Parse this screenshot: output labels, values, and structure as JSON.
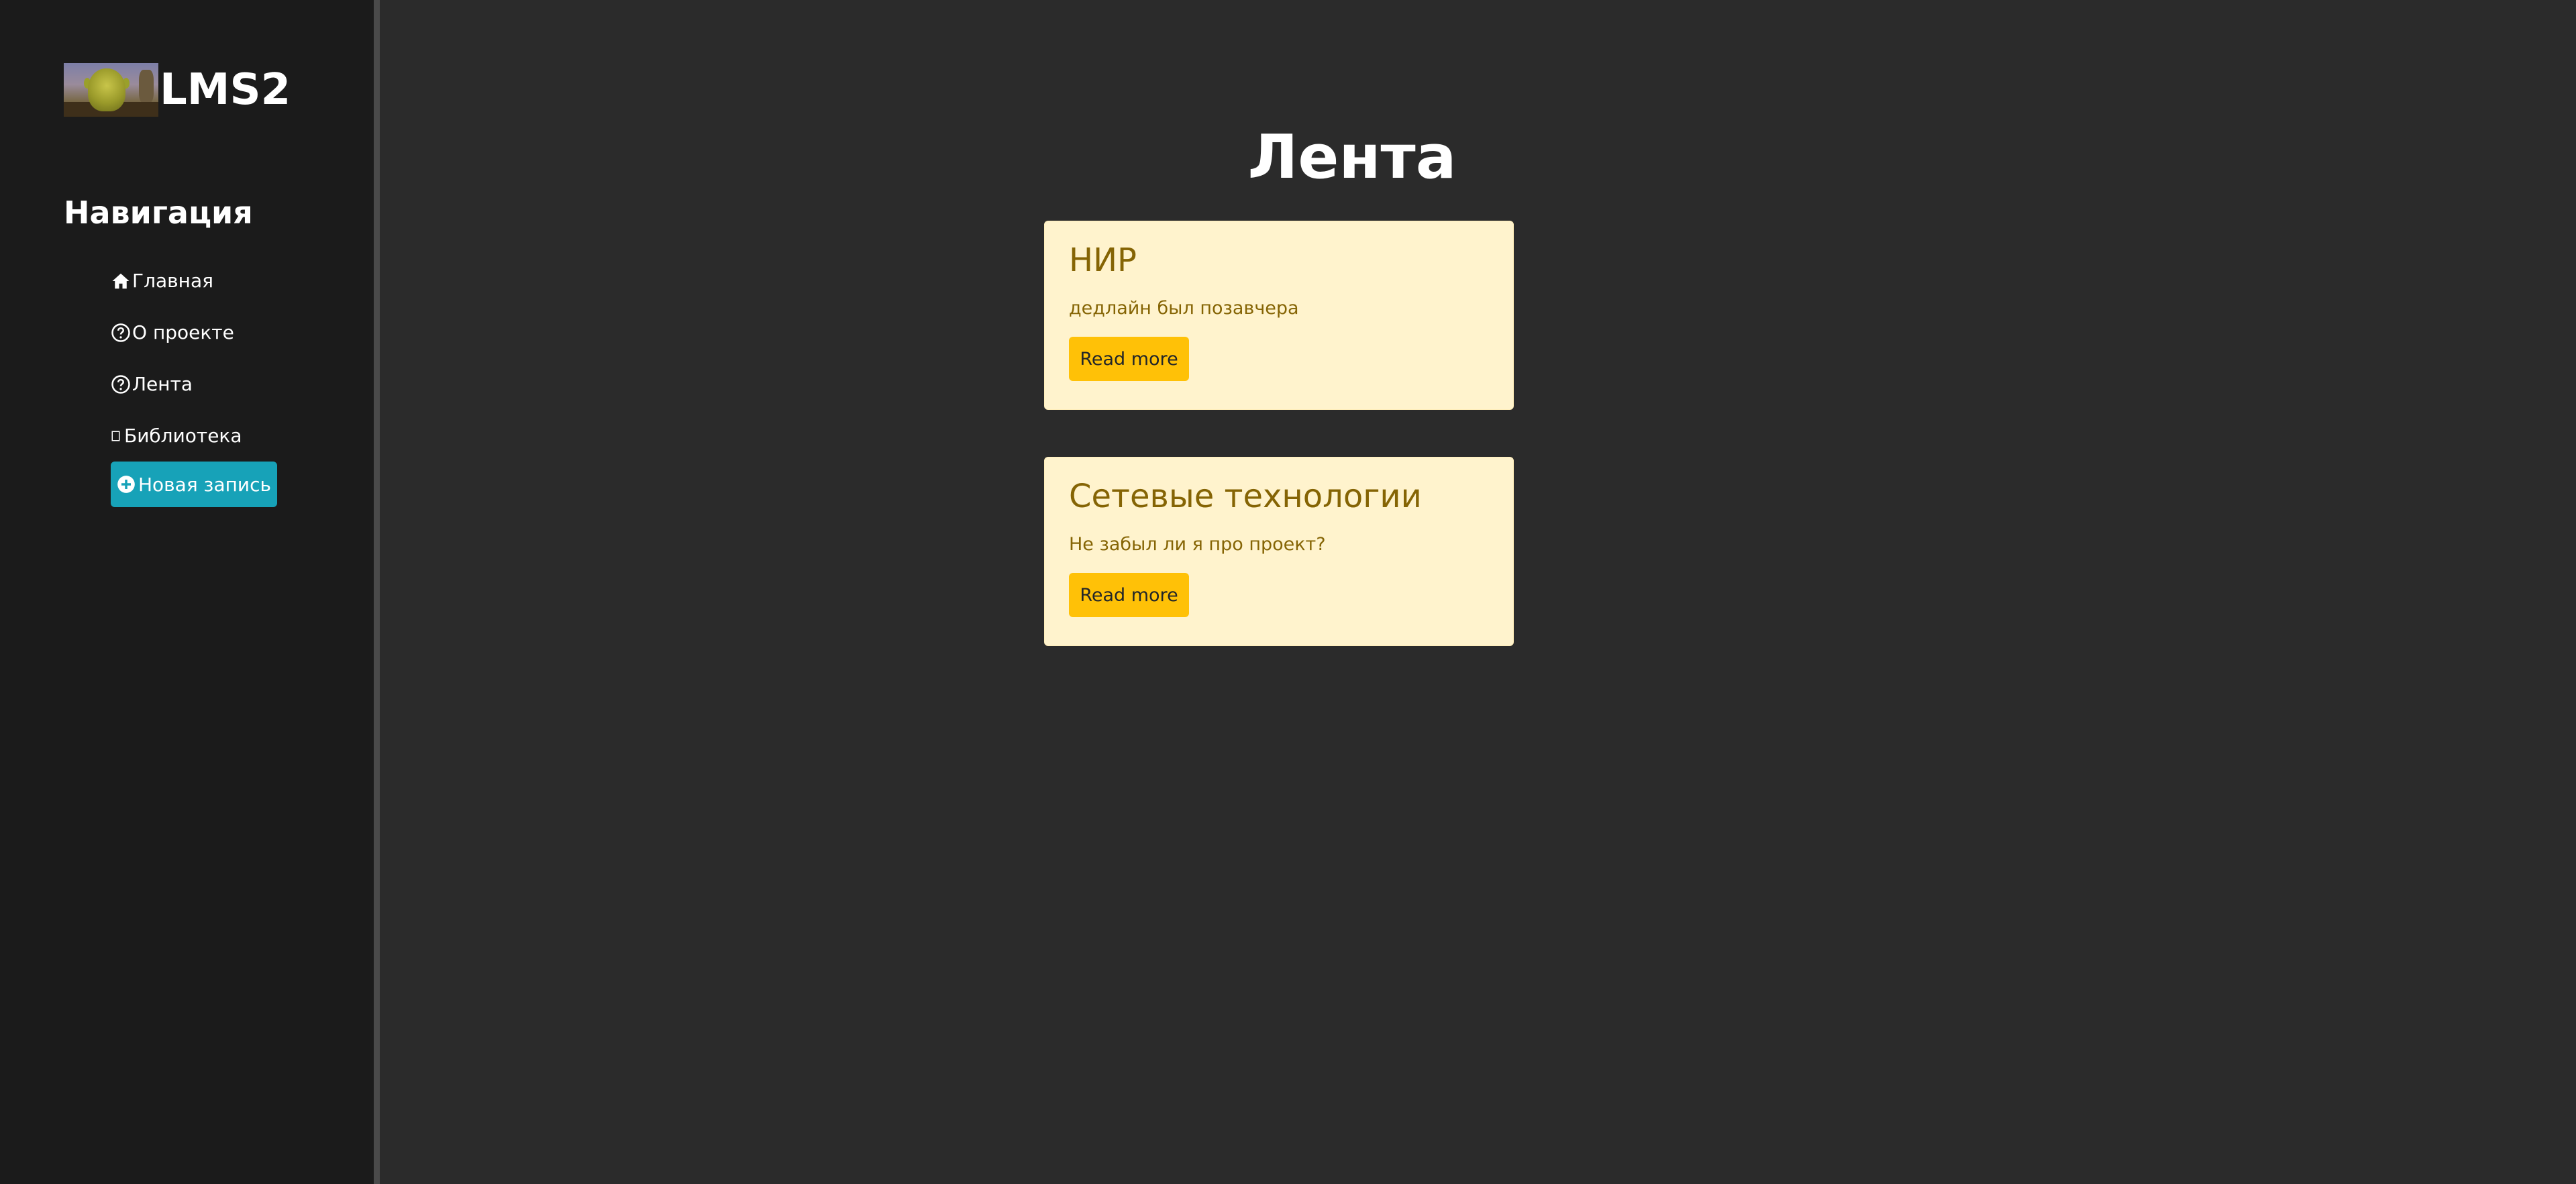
{
  "brand": {
    "name": "LMS2"
  },
  "sidebar": {
    "title": "Навигация",
    "items": [
      {
        "label": "Главная",
        "icon": "home-icon"
      },
      {
        "label": "О проекте",
        "icon": "question-circle-icon"
      },
      {
        "label": "Лента",
        "icon": "question-circle-icon"
      },
      {
        "label": "Библиотека",
        "icon": "missing-glyph-icon"
      }
    ],
    "new_button": {
      "label": "Новая запись",
      "icon": "plus-circle-icon"
    }
  },
  "main": {
    "title": "Лента",
    "posts": [
      {
        "title": "НИР",
        "text": "дедлайн был позавчера",
        "button": "Read more"
      },
      {
        "title": "Сетевые технологии",
        "text": "Не забыл ли я про проект?",
        "button": "Read more"
      }
    ]
  },
  "colors": {
    "sidebar_bg": "#1b1b1b",
    "main_bg": "#2b2b2b",
    "accent_info": "#17a2b8",
    "card_bg": "#fff3cd",
    "card_text": "#856404",
    "button_warning": "#ffc107"
  }
}
